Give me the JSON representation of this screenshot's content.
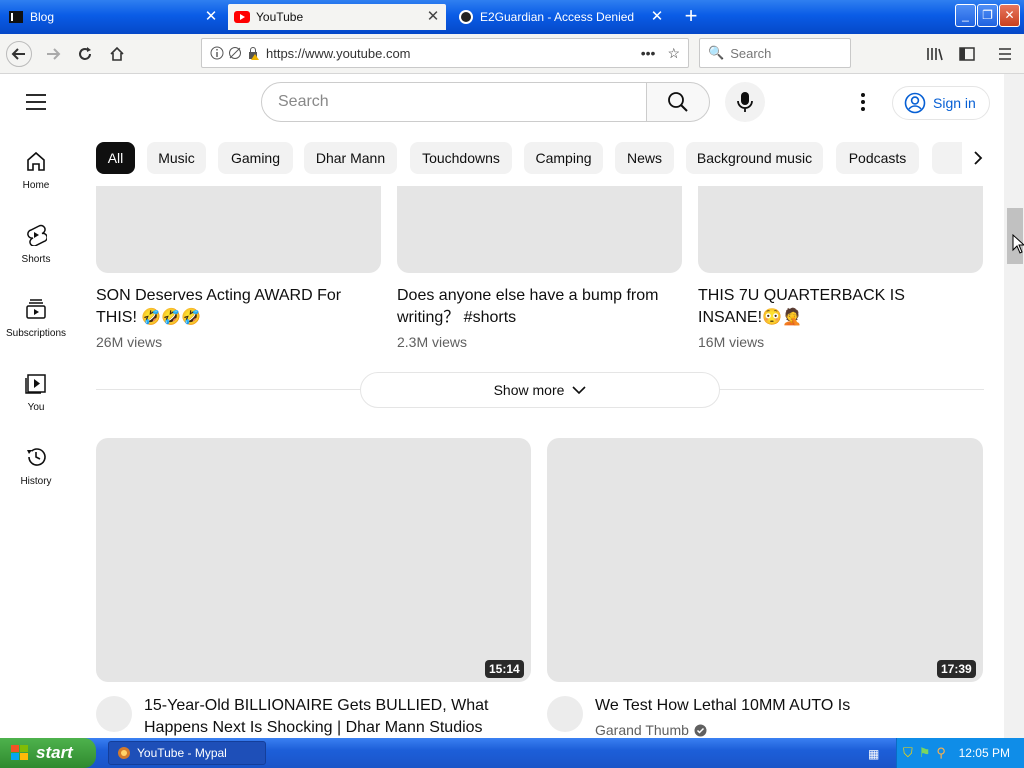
{
  "browser": {
    "tabs": [
      {
        "title": "Blog",
        "active": false
      },
      {
        "title": "YouTube",
        "active": true
      },
      {
        "title": "E2Guardian - Access Denied",
        "active": false
      }
    ],
    "new_tab_glyph": "+",
    "url": "https://www.youtube.com",
    "search_placeholder": "Search",
    "window_buttons": {
      "minimize": "_",
      "restore": "❐",
      "close": "✕"
    }
  },
  "youtube": {
    "search_placeholder": "Search",
    "sign_in": "Sign in",
    "chips": [
      "All",
      "Music",
      "Gaming",
      "Dhar Mann",
      "Touchdowns",
      "Camping",
      "News",
      "Background music",
      "Podcasts"
    ],
    "guide": [
      {
        "label": "Home",
        "icon": "home-icon"
      },
      {
        "label": "Shorts",
        "icon": "shorts-icon"
      },
      {
        "label": "Subscriptions",
        "icon": "subscriptions-icon"
      },
      {
        "label": "You",
        "icon": "you-icon"
      },
      {
        "label": "History",
        "icon": "history-icon"
      }
    ],
    "shorts": [
      {
        "title": "SON Deserves Acting AWARD For THIS! 🤣🤣🤣",
        "views": "26M views"
      },
      {
        "title": "Does anyone else have a bump from writing？ #shorts",
        "views": "2.3M views"
      },
      {
        "title": "THIS 7U QUARTERBACK IS INSANE!😳🤦",
        "views": "16M views"
      }
    ],
    "show_more": "Show more",
    "videos": [
      {
        "duration": "15:14",
        "title": "15-Year-Old BILLIONAIRE Gets BULLIED, What Happens Next Is Shocking | Dhar Mann Studios",
        "channel": ""
      },
      {
        "duration": "17:39",
        "title": "We Test How Lethal 10MM AUTO Is",
        "channel": "Garand Thumb"
      }
    ]
  },
  "taskbar": {
    "start": "start",
    "task": "YouTube - Mypal",
    "clock": "12:05 PM"
  }
}
